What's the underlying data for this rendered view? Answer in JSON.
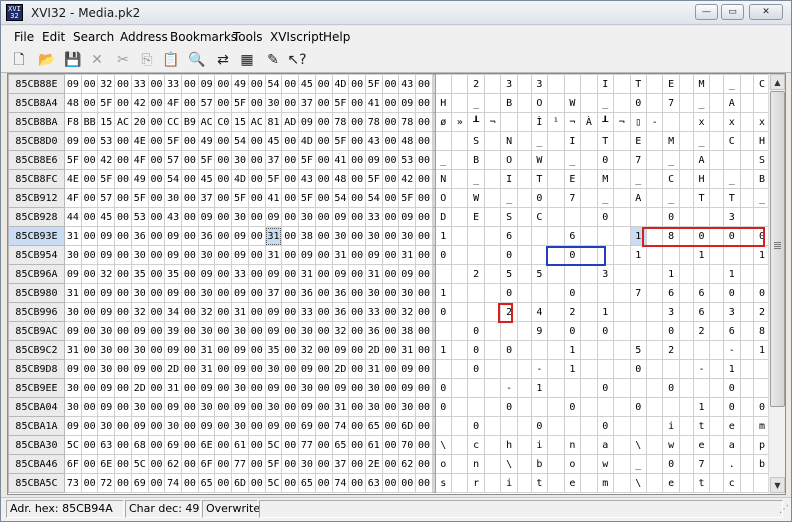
{
  "window": {
    "title": "XVI32 - Media.pk2",
    "icon_text": "XVI32"
  },
  "window_controls": {
    "minimize": "—",
    "maximize": "▭",
    "close": "✕"
  },
  "menu": [
    "File",
    "Edit",
    "Search",
    "Address",
    "Bookmarks",
    "Tools",
    "XVIscript",
    "Help"
  ],
  "toolbar": [
    {
      "icon": "new-file-icon",
      "glyph": "🗋",
      "enabled": true
    },
    {
      "icon": "open-folder-icon",
      "glyph": "📂",
      "enabled": true
    },
    {
      "icon": "save-icon",
      "glyph": "💾",
      "enabled": true
    },
    {
      "icon": "delete-icon",
      "glyph": "✕",
      "enabled": false
    },
    {
      "icon": "cut-icon",
      "glyph": "✂",
      "enabled": false
    },
    {
      "icon": "copy-icon",
      "glyph": "⎘",
      "enabled": false
    },
    {
      "icon": "paste-icon",
      "glyph": "📋",
      "enabled": true
    },
    {
      "icon": "search-icon",
      "glyph": "🔍",
      "enabled": true
    },
    {
      "icon": "replace-icon",
      "glyph": "⇄",
      "enabled": true
    },
    {
      "icon": "properties-icon",
      "glyph": "▦",
      "enabled": true
    },
    {
      "icon": "script-icon",
      "glyph": "✎",
      "enabled": true
    },
    {
      "icon": "help-pointer-icon",
      "glyph": "↖?",
      "enabled": true
    }
  ],
  "hex_rows": [
    {
      "addr": "85CB88E",
      "hex": [
        "09",
        "00",
        "32",
        "00",
        "33",
        "00",
        "33",
        "00",
        "09",
        "00",
        "49",
        "00",
        "54",
        "00",
        "45",
        "00",
        "4D",
        "00",
        "5F",
        "00",
        "43",
        "00"
      ],
      "chars": [
        "",
        "",
        "2",
        "",
        "3",
        "",
        "3",
        "",
        "",
        "",
        "I",
        "",
        "T",
        "",
        "E",
        "",
        "M",
        "",
        "_",
        "",
        "C",
        ""
      ]
    },
    {
      "addr": "85CB8A4",
      "hex": [
        "48",
        "00",
        "5F",
        "00",
        "42",
        "00",
        "4F",
        "00",
        "57",
        "00",
        "5F",
        "00",
        "30",
        "00",
        "37",
        "00",
        "5F",
        "00",
        "41",
        "00",
        "09",
        "00"
      ],
      "chars": [
        "H",
        "",
        "_",
        "",
        "B",
        "",
        "O",
        "",
        "W",
        "",
        "_",
        "",
        "0",
        "",
        "7",
        "",
        "_",
        "",
        "A",
        "",
        "",
        ""
      ]
    },
    {
      "addr": "85CB8BA",
      "hex": [
        "F8",
        "BB",
        "15",
        "AC",
        "20",
        "00",
        "CC",
        "B9",
        "AC",
        "C0",
        "15",
        "AC",
        "81",
        "AD",
        "09",
        "00",
        "78",
        "00",
        "78",
        "00",
        "78",
        "00"
      ],
      "chars": [
        "ø",
        "»",
        "┸",
        "¬",
        "",
        "",
        "Ì",
        "¹",
        "¬",
        "À",
        "┸",
        "¬",
        "▯",
        "-",
        "",
        "",
        "x",
        "",
        "x",
        "",
        "x",
        ""
      ]
    },
    {
      "addr": "85CB8D0",
      "hex": [
        "09",
        "00",
        "53",
        "00",
        "4E",
        "00",
        "5F",
        "00",
        "49",
        "00",
        "54",
        "00",
        "45",
        "00",
        "4D",
        "00",
        "5F",
        "00",
        "43",
        "00",
        "48",
        "00"
      ],
      "chars": [
        "",
        "",
        "S",
        "",
        "N",
        "",
        "_",
        "",
        "I",
        "",
        "T",
        "",
        "E",
        "",
        "M",
        "",
        "_",
        "",
        "C",
        "",
        "H",
        ""
      ]
    },
    {
      "addr": "85CB8E6",
      "hex": [
        "5F",
        "00",
        "42",
        "00",
        "4F",
        "00",
        "57",
        "00",
        "5F",
        "00",
        "30",
        "00",
        "37",
        "00",
        "5F",
        "00",
        "41",
        "00",
        "09",
        "00",
        "53",
        "00"
      ],
      "chars": [
        "_",
        "",
        "B",
        "",
        "O",
        "",
        "W",
        "",
        "_",
        "",
        "0",
        "",
        "7",
        "",
        "_",
        "",
        "A",
        "",
        "",
        "",
        "S",
        ""
      ]
    },
    {
      "addr": "85CB8FC",
      "hex": [
        "4E",
        "00",
        "5F",
        "00",
        "49",
        "00",
        "54",
        "00",
        "45",
        "00",
        "4D",
        "00",
        "5F",
        "00",
        "43",
        "00",
        "48",
        "00",
        "5F",
        "00",
        "42",
        "00"
      ],
      "chars": [
        "N",
        "",
        "_",
        "",
        "I",
        "",
        "T",
        "",
        "E",
        "",
        "M",
        "",
        "_",
        "",
        "C",
        "",
        "H",
        "",
        "_",
        "",
        "B",
        ""
      ]
    },
    {
      "addr": "85CB912",
      "hex": [
        "4F",
        "00",
        "57",
        "00",
        "5F",
        "00",
        "30",
        "00",
        "37",
        "00",
        "5F",
        "00",
        "41",
        "00",
        "5F",
        "00",
        "54",
        "00",
        "54",
        "00",
        "5F",
        "00"
      ],
      "chars": [
        "O",
        "",
        "W",
        "",
        "_",
        "",
        "0",
        "",
        "7",
        "",
        "_",
        "",
        "A",
        "",
        "_",
        "",
        "T",
        "",
        "T",
        "",
        "_",
        ""
      ]
    },
    {
      "addr": "85CB928",
      "hex": [
        "44",
        "00",
        "45",
        "00",
        "53",
        "00",
        "43",
        "00",
        "09",
        "00",
        "30",
        "00",
        "09",
        "00",
        "30",
        "00",
        "09",
        "00",
        "33",
        "00",
        "09",
        "00"
      ],
      "chars": [
        "D",
        "",
        "E",
        "",
        "S",
        "",
        "C",
        "",
        "",
        "",
        "0",
        "",
        "",
        "",
        "0",
        "",
        "",
        "",
        "3",
        "",
        "",
        ""
      ]
    },
    {
      "addr": "85CB93E",
      "hex": [
        "31",
        "00",
        "09",
        "00",
        "36",
        "00",
        "09",
        "00",
        "36",
        "00",
        "09",
        "00",
        "31",
        "00",
        "38",
        "00",
        "30",
        "00",
        "30",
        "00",
        "30",
        "00"
      ],
      "chars": [
        "1",
        "",
        "",
        "",
        "6",
        "",
        "",
        "",
        "6",
        "",
        "",
        "",
        "1",
        "",
        "8",
        "",
        "0",
        "",
        "0",
        "",
        "0",
        ""
      ]
    },
    {
      "addr": "85CB954",
      "hex": [
        "30",
        "00",
        "09",
        "00",
        "30",
        "00",
        "09",
        "00",
        "30",
        "00",
        "09",
        "00",
        "31",
        "00",
        "09",
        "00",
        "31",
        "00",
        "09",
        "00",
        "31",
        "00"
      ],
      "chars": [
        "0",
        "",
        "",
        "",
        "0",
        "",
        "",
        "",
        "0",
        "",
        "",
        "",
        "1",
        "",
        "",
        "",
        "1",
        "",
        "",
        "",
        "1",
        ""
      ]
    },
    {
      "addr": "85CB96A",
      "hex": [
        "09",
        "00",
        "32",
        "00",
        "35",
        "00",
        "35",
        "00",
        "09",
        "00",
        "33",
        "00",
        "09",
        "00",
        "31",
        "00",
        "09",
        "00",
        "31",
        "00",
        "09",
        "00"
      ],
      "chars": [
        "",
        "",
        "2",
        "",
        "5",
        "",
        "5",
        "",
        "",
        "",
        "3",
        "",
        "",
        "",
        "1",
        "",
        "",
        "",
        "1",
        "",
        "",
        ""
      ]
    },
    {
      "addr": "85CB980",
      "hex": [
        "31",
        "00",
        "09",
        "00",
        "30",
        "00",
        "09",
        "00",
        "30",
        "00",
        "09",
        "00",
        "37",
        "00",
        "36",
        "00",
        "36",
        "00",
        "30",
        "00",
        "30",
        "00"
      ],
      "chars": [
        "1",
        "",
        "",
        "",
        "0",
        "",
        "",
        "",
        "0",
        "",
        "",
        "",
        "7",
        "",
        "6",
        "",
        "6",
        "",
        "0",
        "",
        "0",
        ""
      ]
    },
    {
      "addr": "85CB996",
      "hex": [
        "30",
        "00",
        "09",
        "00",
        "32",
        "00",
        "34",
        "00",
        "32",
        "00",
        "31",
        "00",
        "09",
        "00",
        "33",
        "00",
        "36",
        "00",
        "33",
        "00",
        "32",
        "00"
      ],
      "chars": [
        "0",
        "",
        "",
        "",
        "2",
        "",
        "4",
        "",
        "2",
        "",
        "1",
        "",
        "",
        "",
        "3",
        "",
        "6",
        "",
        "3",
        "",
        "2",
        ""
      ]
    },
    {
      "addr": "85CB9AC",
      "hex": [
        "09",
        "00",
        "30",
        "00",
        "09",
        "00",
        "39",
        "00",
        "30",
        "00",
        "30",
        "00",
        "09",
        "00",
        "30",
        "00",
        "32",
        "00",
        "36",
        "00",
        "38",
        "00"
      ],
      "chars": [
        "",
        "",
        "0",
        "",
        "",
        "",
        "9",
        "",
        "0",
        "",
        "0",
        "",
        "",
        "",
        "0",
        "",
        "2",
        "",
        "6",
        "",
        "8",
        ""
      ]
    },
    {
      "addr": "85CB9C2",
      "hex": [
        "31",
        "00",
        "30",
        "00",
        "30",
        "00",
        "09",
        "00",
        "31",
        "00",
        "09",
        "00",
        "35",
        "00",
        "32",
        "00",
        "09",
        "00",
        "2D",
        "00",
        "31",
        "00"
      ],
      "chars": [
        "1",
        "",
        "0",
        "",
        "0",
        "",
        "",
        "",
        "1",
        "",
        "",
        "",
        "5",
        "",
        "2",
        "",
        "",
        "",
        "-",
        "",
        "1",
        ""
      ]
    },
    {
      "addr": "85CB9D8",
      "hex": [
        "09",
        "00",
        "30",
        "00",
        "09",
        "00",
        "2D",
        "00",
        "31",
        "00",
        "09",
        "00",
        "30",
        "00",
        "09",
        "00",
        "2D",
        "00",
        "31",
        "00",
        "09",
        "00"
      ],
      "chars": [
        "",
        "",
        "0",
        "",
        "",
        "",
        "-",
        "",
        "1",
        "",
        "",
        "",
        "0",
        "",
        "",
        "",
        "-",
        "",
        "1",
        "",
        "",
        ""
      ]
    },
    {
      "addr": "85CB9EE",
      "hex": [
        "30",
        "00",
        "09",
        "00",
        "2D",
        "00",
        "31",
        "00",
        "09",
        "00",
        "30",
        "00",
        "09",
        "00",
        "30",
        "00",
        "09",
        "00",
        "30",
        "00",
        "09",
        "00"
      ],
      "chars": [
        "0",
        "",
        "",
        "",
        "-",
        "",
        "1",
        "",
        "",
        "",
        "0",
        "",
        "",
        "",
        "0",
        "",
        "",
        "",
        "0",
        "",
        "",
        ""
      ]
    },
    {
      "addr": "85CBA04",
      "hex": [
        "30",
        "00",
        "09",
        "00",
        "30",
        "00",
        "09",
        "00",
        "30",
        "00",
        "09",
        "00",
        "30",
        "00",
        "09",
        "00",
        "31",
        "00",
        "30",
        "00",
        "30",
        "00"
      ],
      "chars": [
        "0",
        "",
        "",
        "",
        "0",
        "",
        "",
        "",
        "0",
        "",
        "",
        "",
        "0",
        "",
        "",
        "",
        "1",
        "",
        "0",
        "",
        "0",
        ""
      ]
    },
    {
      "addr": "85CBA1A",
      "hex": [
        "09",
        "00",
        "30",
        "00",
        "09",
        "00",
        "30",
        "00",
        "09",
        "00",
        "30",
        "00",
        "09",
        "00",
        "69",
        "00",
        "74",
        "00",
        "65",
        "00",
        "6D",
        "00"
      ],
      "chars": [
        "",
        "",
        "0",
        "",
        "",
        "",
        "0",
        "",
        "",
        "",
        "0",
        "",
        "",
        "",
        "i",
        "",
        "t",
        "",
        "e",
        "",
        "m",
        ""
      ]
    },
    {
      "addr": "85CBA30",
      "hex": [
        "5C",
        "00",
        "63",
        "00",
        "68",
        "00",
        "69",
        "00",
        "6E",
        "00",
        "61",
        "00",
        "5C",
        "00",
        "77",
        "00",
        "65",
        "00",
        "61",
        "00",
        "70",
        "00"
      ],
      "chars": [
        "\\",
        "",
        "c",
        "",
        "h",
        "",
        "i",
        "",
        "n",
        "",
        "a",
        "",
        "\\",
        "",
        "w",
        "",
        "e",
        "",
        "a",
        "",
        "p",
        ""
      ]
    },
    {
      "addr": "85CBA46",
      "hex": [
        "6F",
        "00",
        "6E",
        "00",
        "5C",
        "00",
        "62",
        "00",
        "6F",
        "00",
        "77",
        "00",
        "5F",
        "00",
        "30",
        "00",
        "37",
        "00",
        "2E",
        "00",
        "62",
        "00"
      ],
      "chars": [
        "o",
        "",
        "n",
        "",
        "\\",
        "",
        "b",
        "",
        "o",
        "",
        "w",
        "",
        "_",
        "",
        "0",
        "",
        "7",
        "",
        ".",
        " ",
        "b",
        ""
      ]
    },
    {
      "addr": "85CBA5C",
      "hex": [
        "73",
        "00",
        "72",
        "00",
        "69",
        "00",
        "74",
        "00",
        "65",
        "00",
        "6D",
        "00",
        "5C",
        "00",
        "65",
        "00",
        "74",
        "00",
        "63",
        "00",
        "00",
        "00"
      ],
      "chars": [
        "s",
        "",
        "r",
        "",
        "i",
        "",
        "t",
        "",
        "e",
        "",
        "m",
        "",
        "\\",
        "",
        "e",
        "",
        "t",
        "",
        "c",
        "",
        "",
        ""
      ]
    }
  ],
  "scrollbar": {
    "up": "▲",
    "down": "▼"
  },
  "status": {
    "adr": "Adr. hex: 85CB94A",
    "char": "Char dec: 49",
    "mode": "Overwrite"
  }
}
